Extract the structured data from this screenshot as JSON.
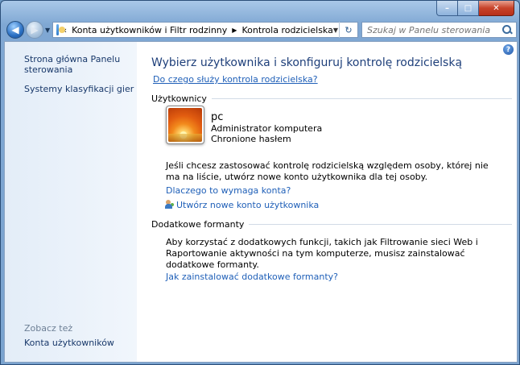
{
  "window": {
    "caption": {
      "minimize": "–",
      "maximize": "□",
      "close": "✕"
    }
  },
  "nav": {
    "back_icon": "back-arrow-icon",
    "forward_icon": "forward-arrow-icon",
    "breadcrumb": [
      "Konta użytkowników i Filtr rodzinny",
      "Kontrola rodzicielska"
    ],
    "breadcrumb_prefix": "«",
    "search_placeholder": "Szukaj w Panelu sterowania"
  },
  "sidebar": {
    "home_link": "Strona główna Panelu sterowania",
    "home_line1": "Strona główna Panelu",
    "home_line2": "sterowania",
    "games_link": "Systemy klasyfikacji gier",
    "see_also": "Zobacz też",
    "accounts_link": "Konta użytkowników"
  },
  "main": {
    "title": "Wybierz użytkownika i skonfiguruj kontrolę rodzicielską",
    "what_link": "Do czego służy kontrola rodzicielska?",
    "users_header": "Użytkownicy",
    "user": {
      "name": "pc",
      "role": "Administrator komputera",
      "status": "Chronione hasłem"
    },
    "info_line1": "Jeśli chcesz zastosować kontrolę rodzicielską względem osoby, której nie",
    "info_line2": "ma na liście, utwórz nowe konto użytkownika dla tej osoby.",
    "why_link": "Dlaczego to wymaga konta?",
    "create_link": "Utwórz nowe konto użytkownika",
    "additional_header": "Dodatkowe formanty",
    "additional_line1": "Aby korzystać z dodatkowych funkcji, takich jak Filtrowanie sieci Web i",
    "additional_line2": "Raportowanie aktywności na tym komputerze, musisz zainstalować",
    "additional_line3": "dodatkowe formanty.",
    "install_link": "Jak zainstalować dodatkowe formanty?",
    "help": "?"
  }
}
